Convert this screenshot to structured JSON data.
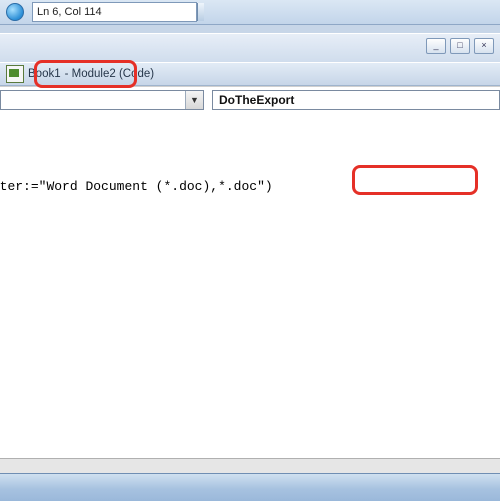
{
  "statusbar": {
    "cursor_position": "Ln 6, Col 114"
  },
  "window_controls": {
    "minimize": "_",
    "maximize": "□",
    "close": "×"
  },
  "code_window": {
    "title_prefix": "Book1",
    "title_highlight": "- Module2 (Code)"
  },
  "dropdowns": {
    "object": "",
    "procedure": "DoTheExport"
  },
  "code": {
    "line": "alFileName:=vbNullStrin, FileFilter:=\"Word Document (*.doc),*.doc\")",
    "top_px": "67px"
  },
  "annotations": {
    "present": true
  }
}
